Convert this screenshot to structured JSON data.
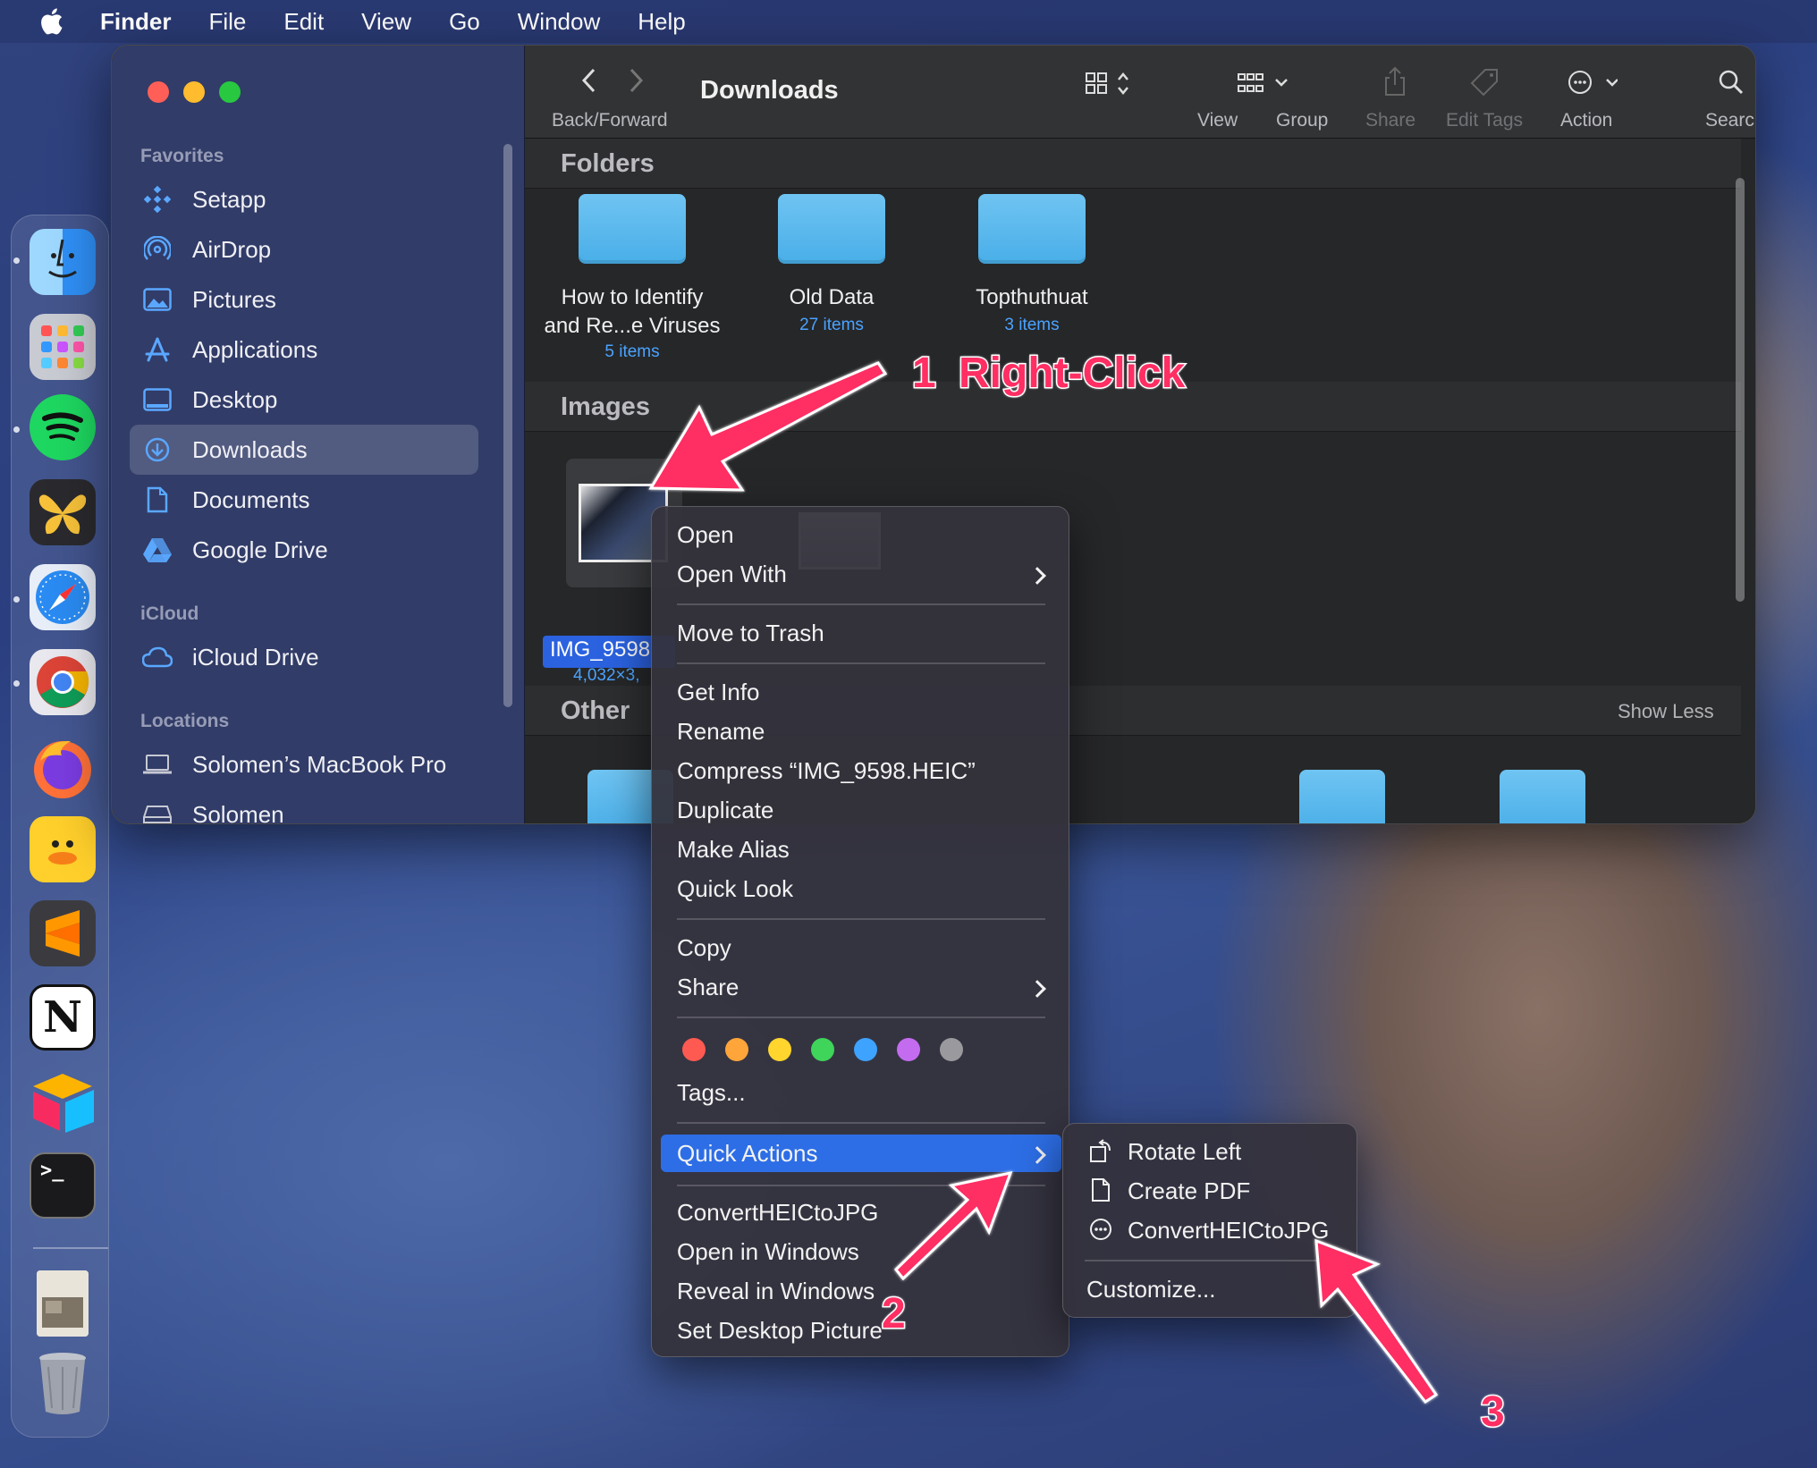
{
  "menubar": {
    "app": "Finder",
    "items": [
      "File",
      "Edit",
      "View",
      "Go",
      "Window",
      "Help"
    ]
  },
  "sidebar": {
    "favorites_label": "Favorites",
    "favorites": [
      "Setapp",
      "AirDrop",
      "Pictures",
      "Applications",
      "Desktop",
      "Downloads",
      "Documents",
      "Google Drive"
    ],
    "selected": "Downloads",
    "icloud_label": "iCloud",
    "icloud": [
      "iCloud Drive"
    ],
    "locations_label": "Locations",
    "locations": [
      "Solomen’s MacBook Pro",
      "Solomen"
    ]
  },
  "toolbar": {
    "title": "Downloads",
    "back_forward": "Back/Forward",
    "view": "View",
    "group": "Group",
    "share": "Share",
    "edit_tags": "Edit Tags",
    "action": "Action",
    "search": "Search"
  },
  "content": {
    "folders_title": "Folders",
    "folders": [
      {
        "name_line1": "How to Identify",
        "name_line2": "and Re...e Viruses",
        "count": "5 items"
      },
      {
        "name_line1": "Old Data",
        "name_line2": "",
        "count": "27 items"
      },
      {
        "name_line1": "Topthuthuat",
        "name_line2": "",
        "count": "3 items"
      }
    ],
    "images_title": "Images",
    "image_name": "IMG_9598",
    "image_dims": "4,032×3,",
    "other_title": "Other",
    "show_less": "Show Less"
  },
  "context_menu": {
    "open": "Open",
    "open_with": "Open With",
    "move_to_trash": "Move to Trash",
    "get_info": "Get Info",
    "rename": "Rename",
    "compress": "Compress “IMG_9598.HEIC”",
    "duplicate": "Duplicate",
    "make_alias": "Make Alias",
    "quick_look": "Quick Look",
    "copy": "Copy",
    "share": "Share",
    "tag_colors": [
      "#ff5a52",
      "#ffa53a",
      "#ffd52e",
      "#3fd45a",
      "#3ea2ff",
      "#c46cf0",
      "#9a9a9e"
    ],
    "tags": "Tags...",
    "quick_actions": "Quick Actions",
    "convert": "ConvertHEICtoJPG",
    "open_in_windows": "Open in Windows",
    "reveal_in_windows": "Reveal in Windows",
    "set_desktop": "Set Desktop Picture"
  },
  "submenu": {
    "rotate_left": "Rotate Left",
    "create_pdf": "Create PDF",
    "convert": "ConvertHEICtoJPG",
    "customize": "Customize..."
  },
  "annotations": {
    "step1_num": "1",
    "step1_text": "Right-Click",
    "step2": "2",
    "step3": "3"
  },
  "colors": {
    "accent": "#2d6ee6",
    "annotation": "#ff2e63",
    "folder": "#5bb8ee"
  }
}
